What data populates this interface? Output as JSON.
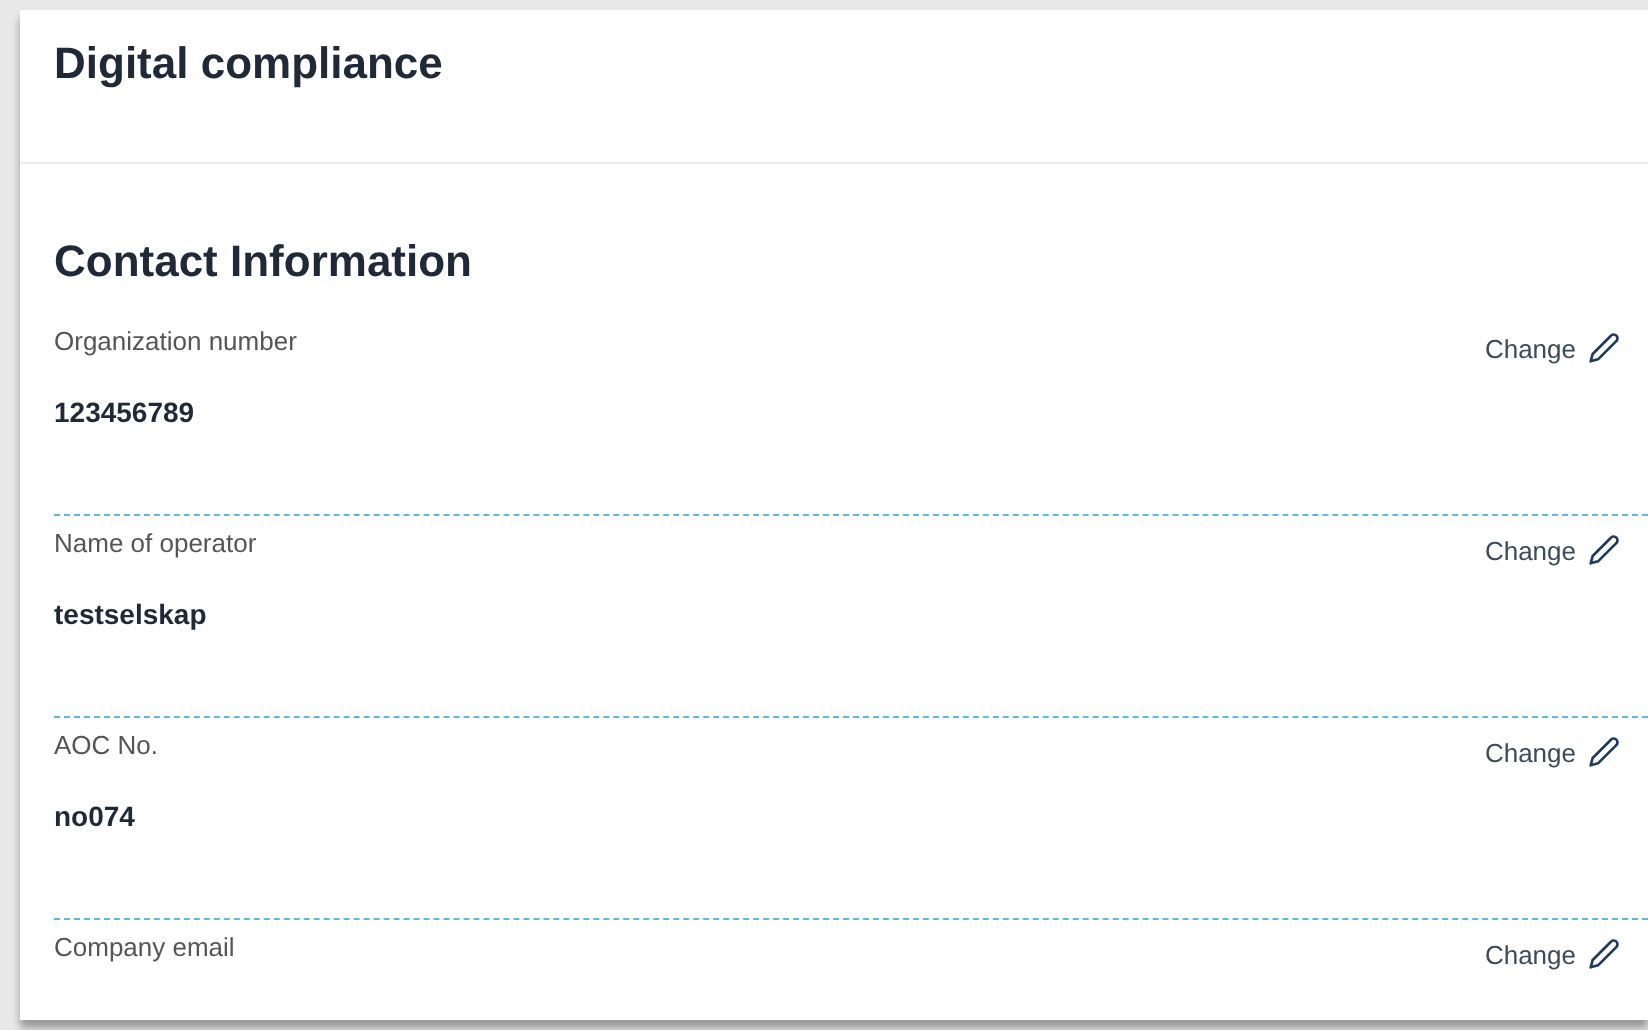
{
  "page": {
    "title": "Digital compliance"
  },
  "section": {
    "heading": "Contact Information",
    "fields": [
      {
        "label": "Organization number",
        "value": "123456789",
        "action": "Change"
      },
      {
        "label": "Name of operator",
        "value": "testselskap",
        "action": "Change"
      },
      {
        "label": "AOC No.",
        "value": "no074",
        "action": "Change"
      },
      {
        "label": "Company email",
        "action": "Change"
      }
    ]
  }
}
